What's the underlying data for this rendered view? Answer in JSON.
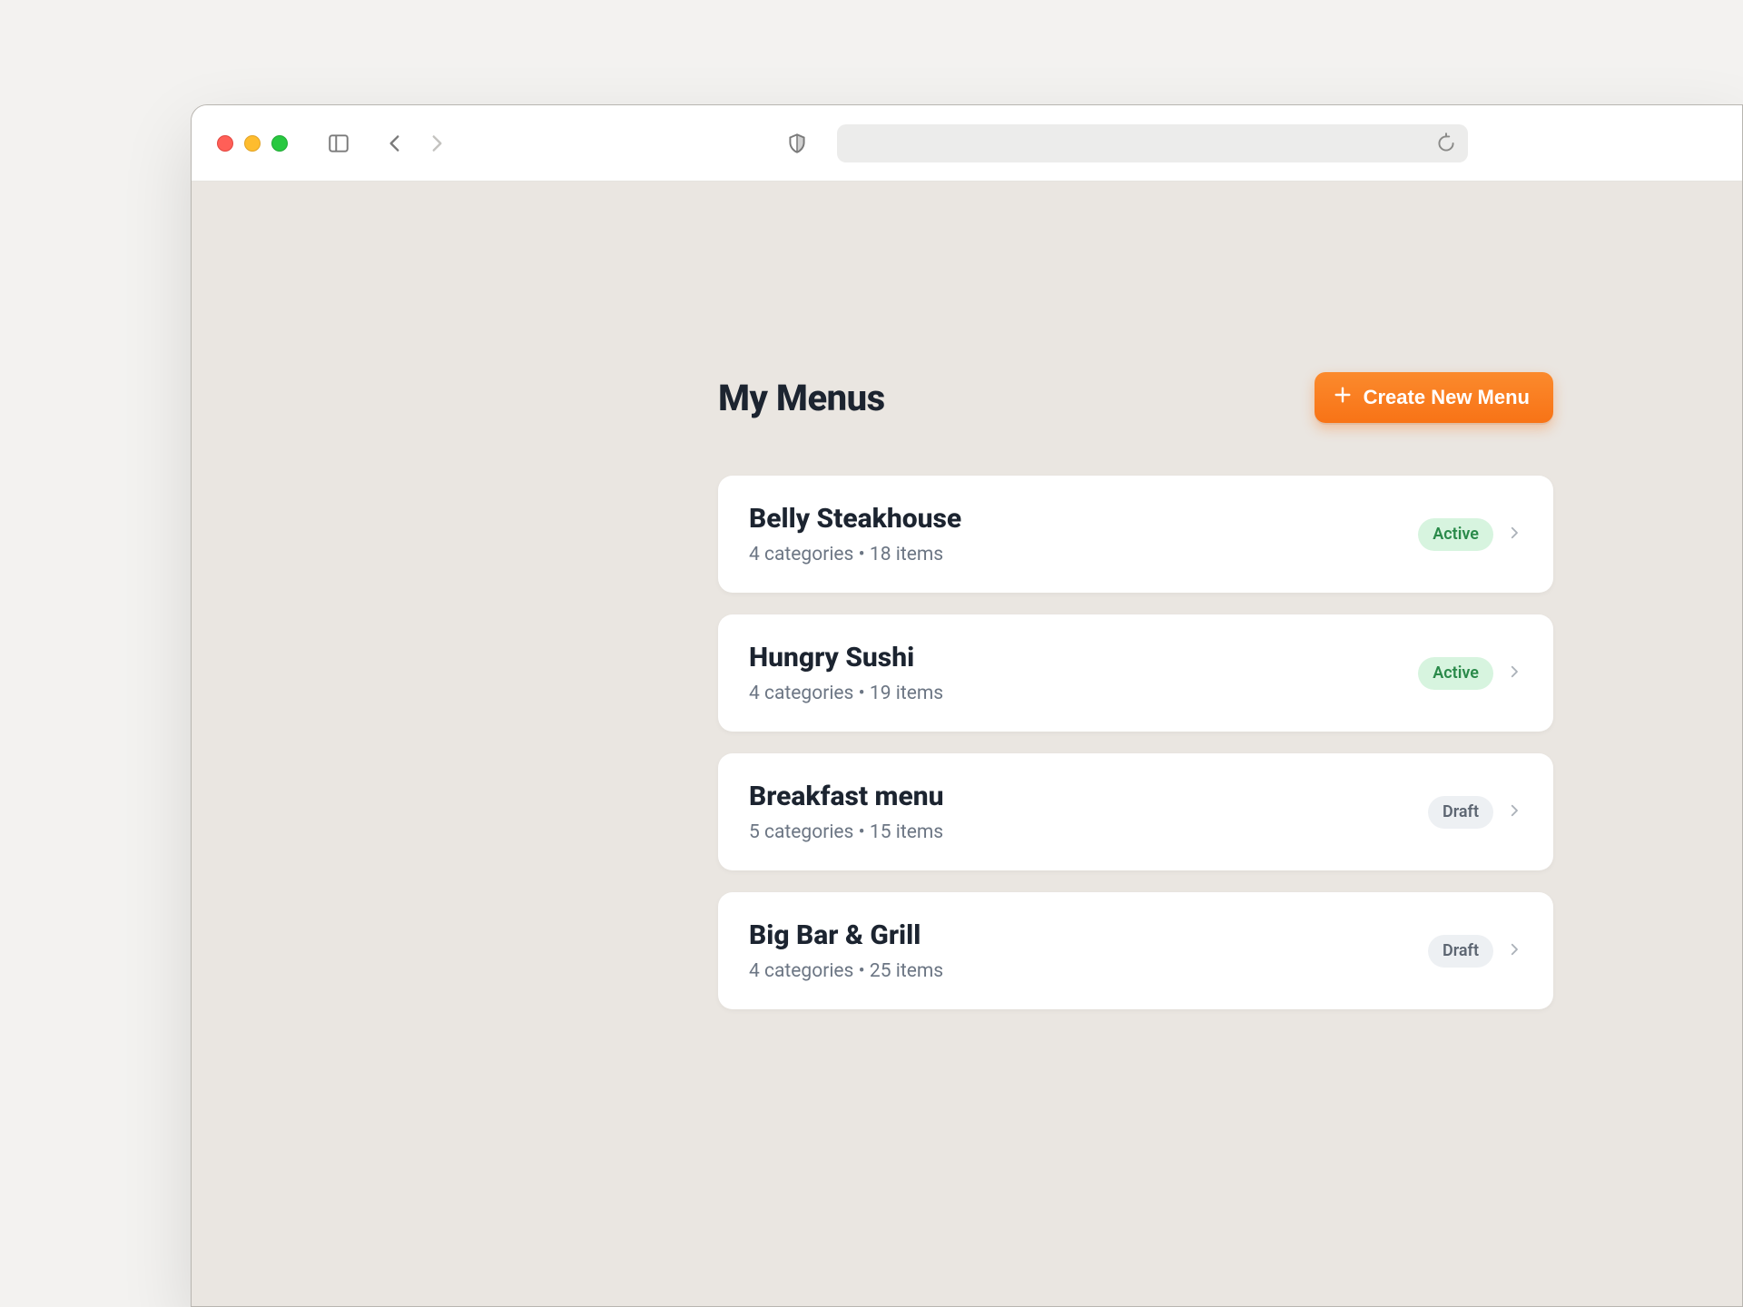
{
  "page": {
    "title": "My Menus",
    "create_label": "Create New Menu"
  },
  "status_labels": {
    "active": "Active",
    "draft": "Draft"
  },
  "menus": [
    {
      "name": "Belly Steakhouse",
      "sub": "4 categories • 18 items",
      "status": "active"
    },
    {
      "name": "Hungry Sushi",
      "sub": "4 categories • 19 items",
      "status": "active"
    },
    {
      "name": "Breakfast menu",
      "sub": "5 categories • 15 items",
      "status": "draft"
    },
    {
      "name": "Big Bar & Grill",
      "sub": "4 categories • 25 items",
      "status": "draft"
    }
  ]
}
